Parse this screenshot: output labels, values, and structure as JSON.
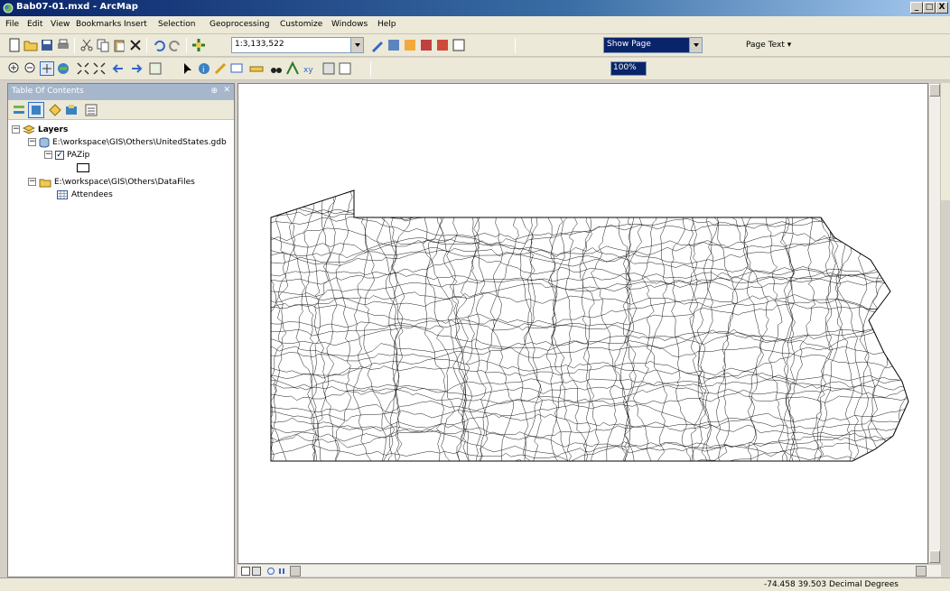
{
  "window": {
    "title": "Bab07-01.mxd - ArcMap",
    "minimize": "_",
    "maximize": "□",
    "close": "X"
  },
  "menu": [
    "File",
    "Edit",
    "View",
    "Bookmarks",
    "Insert",
    "Selection",
    "Geoprocessing",
    "Customize",
    "Windows",
    "Help"
  ],
  "toolbar": {
    "scale": "1:3,133,522",
    "layout_page": "Show Page",
    "page_text": "Page Text ▾",
    "layout_zoom": "100%"
  },
  "toc": {
    "header": "Table Of Contents",
    "header_controls": "⊕",
    "close": "✕",
    "tree": {
      "layers_label": "Layers",
      "gdb_path": "E:\\workspace\\GIS\\Others\\UnitedStates.gdb",
      "layer_name": "PAZip",
      "folder_path": "E:\\workspace\\GIS\\Others\\DataFiles",
      "table_name": "Attendees"
    }
  },
  "status": {
    "coordinates": "-74.458  39.503 Decimal Degrees"
  },
  "colors": {
    "title_start": "#0a246a",
    "panel_bg": "#ece9d8",
    "map_bg": "#ffffff",
    "selection": "#0a246a"
  },
  "icons": [
    "arcmap-icon",
    "new-icon",
    "open-icon",
    "save-icon",
    "print-icon",
    "cut-icon",
    "copy-icon",
    "paste-icon",
    "delete-icon",
    "undo-icon",
    "redo-icon",
    "add-data-icon",
    "zoom-in-icon",
    "zoom-out-icon",
    "pan-icon",
    "full-extent-icon",
    "identify-icon",
    "find-icon",
    "measure-icon"
  ]
}
